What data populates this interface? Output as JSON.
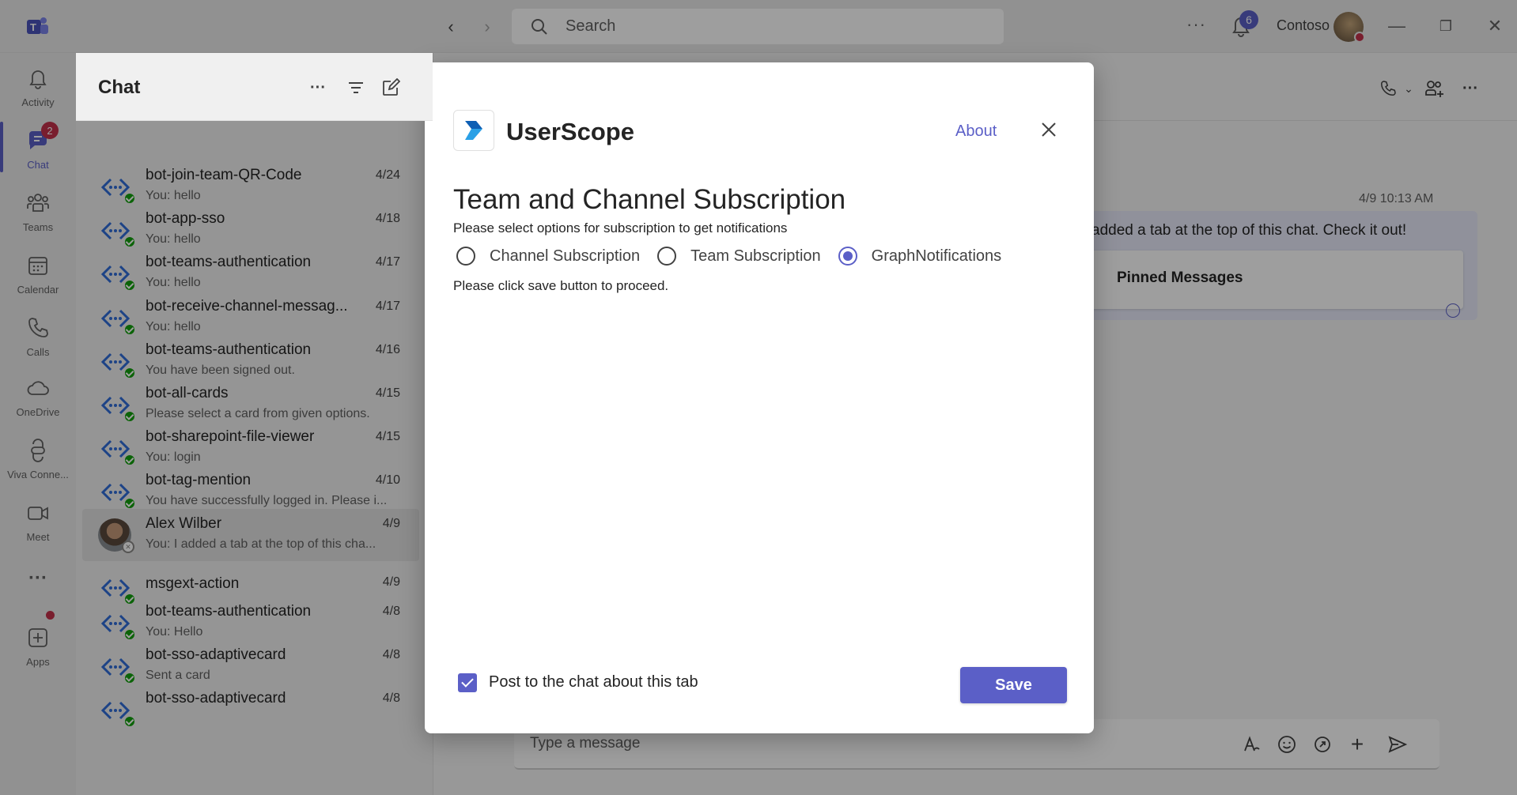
{
  "titlebar": {
    "search_placeholder": "Search",
    "more": "···",
    "notification_count": "6",
    "org_name": "Contoso"
  },
  "rail": {
    "items": [
      {
        "label": "Activity",
        "icon": "bell-icon"
      },
      {
        "label": "Chat",
        "icon": "chat-icon",
        "badge": "2"
      },
      {
        "label": "Teams",
        "icon": "teams-icon"
      },
      {
        "label": "Calendar",
        "icon": "calendar-icon"
      },
      {
        "label": "Calls",
        "icon": "phone-icon"
      },
      {
        "label": "OneDrive",
        "icon": "cloud-icon"
      },
      {
        "label": "Viva Conne...",
        "icon": "viva-icon"
      },
      {
        "label": "Meet",
        "icon": "video-icon"
      },
      {
        "label": "···",
        "icon": "more-icon"
      },
      {
        "label": "Apps",
        "icon": "add-app-icon"
      }
    ]
  },
  "chatlist": {
    "title": "Chat",
    "items": [
      {
        "name": "bot-join-team-QR-Code",
        "date": "4/24",
        "preview": "You: hello"
      },
      {
        "name": "bot-app-sso",
        "date": "4/18",
        "preview": "You: hello"
      },
      {
        "name": "bot-teams-authentication",
        "date": "4/17",
        "preview": "You: hello"
      },
      {
        "name": "bot-receive-channel-messag...",
        "date": "4/17",
        "preview": "You: hello"
      },
      {
        "name": "bot-teams-authentication",
        "date": "4/16",
        "preview": "You have been signed out."
      },
      {
        "name": "bot-all-cards",
        "date": "4/15",
        "preview": "Please select a card from given options."
      },
      {
        "name": "bot-sharepoint-file-viewer",
        "date": "4/15",
        "preview": "You: login"
      },
      {
        "name": "bot-tag-mention",
        "date": "4/10",
        "preview": "You have successfully logged in. Please i..."
      },
      {
        "name": "Alex Wilber",
        "date": "4/9",
        "preview": "You: I added a tab at the top of this cha..."
      },
      {
        "name": "msgext-action",
        "date": "4/9",
        "preview": ""
      },
      {
        "name": "bot-teams-authentication",
        "date": "4/8",
        "preview": "You: Hello"
      },
      {
        "name": "bot-sso-adaptivecard",
        "date": "4/8",
        "preview": "Sent a card"
      },
      {
        "name": "bot-sso-adaptivecard",
        "date": "4/8",
        "preview": ""
      }
    ]
  },
  "conversation": {
    "timestamp": "4/9 10:13 AM",
    "message_text": "added a tab at the top of this chat. Check it out!",
    "pinned_label": "Pinned Messages",
    "composer_placeholder": "Type a message"
  },
  "dialog": {
    "app_name": "UserScope",
    "about_link": "About",
    "heading": "Team and Channel Subscription",
    "subtitle": "Please select options for subscription to get notifications",
    "options": [
      {
        "label": "Channel Subscription",
        "checked": false
      },
      {
        "label": "Team Subscription",
        "checked": false
      },
      {
        "label": "GraphNotifications",
        "checked": true
      }
    ],
    "note": "Please click save button to proceed.",
    "post_checkbox_label": "Post to the chat about this tab",
    "post_checkbox_checked": true,
    "save_label": "Save"
  },
  "colors": {
    "accent": "#5b5fc7",
    "presence_available": "#13a10e",
    "badge": "#c4314b"
  }
}
